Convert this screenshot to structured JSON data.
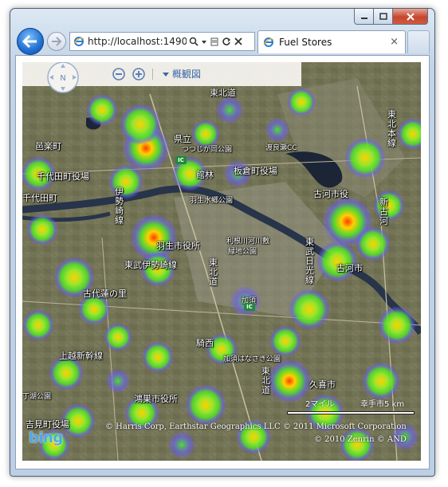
{
  "browser": {
    "address_url": "http://localhost:1490",
    "tab_title": "Fuel Stores",
    "address_tools": [
      "search-icon",
      "dropdown-icon",
      "compat-icon",
      "refresh-icon",
      "stop-icon"
    ]
  },
  "map_controls": {
    "compass_label": "N",
    "map_style_label": "概観図"
  },
  "labels": {
    "tohoku_top": "東北道",
    "tohoku_right": "東北本線",
    "kenmin": "県立",
    "tsutsuji": "つつじが岡公園",
    "ogura": "邑楽町",
    "chiyoda_office": "千代田町役場",
    "chiyoda": "千代田町",
    "watarase_cc": "渡良瀬CC",
    "kuragaya": "館林",
    "itakura_office": "板倉町役場",
    "koga": "古河市役",
    "isesaki_line": "伊勢崎線",
    "hanyu_park": "羽生水郷公園",
    "hanyu_office": "羽生市役所",
    "kamimura": "利根川河川敷",
    "ryokuchi": "緑地公園",
    "tobu_nikko_line": "東武日光線",
    "shinkoga": "新古河",
    "koga_city": "古河市",
    "tobu_isesaki": "東武伊勢崎線",
    "tohoku_mid": "東北道",
    "kazo": "加須",
    "kisai": "騎西",
    "gyoda": "古代蓮の里",
    "joetsu": "上越新幹線",
    "kazo_park": "加須はなさき公園",
    "kounosu_office": "鴻巣市役所",
    "park_left": "丁湖公園",
    "yoshimi_office": "吉見町役場",
    "tohoku_low": "東北道",
    "kuki": "久喜市",
    "higashi_kawa": "東武伊勢崎線"
  },
  "scale": {
    "miles": "2マイル",
    "km": "幸手市5 km"
  },
  "copyright": {
    "line1": "© Harris Corp, Earthstar Geographics LLC   © 2011 Microsoft Corporation",
    "line2": "© 2010 Zenrin  © AND"
  },
  "logo": "bing",
  "colors": {
    "heat_hot": "#ff3b00",
    "heat_warm": "#ffd000",
    "heat_mid": "#4de02c",
    "heat_cool": "#6a5cff",
    "accent": "#3b66a8"
  }
}
